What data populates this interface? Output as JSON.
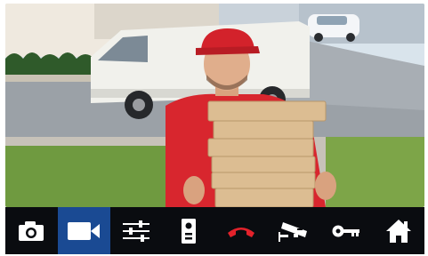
{
  "camera_feed": {
    "description": "",
    "colors": {
      "sky": "#cfe0f0",
      "road": "#8e9399",
      "grass": "#7aa64a",
      "van": "#f2f2ee",
      "shirt": "#d8262e",
      "cap": "#d3222b",
      "boxes": "#d9b98c"
    }
  },
  "toolbar": {
    "active_index": 1,
    "accent_color": "#1a4a93",
    "hangup_color": "#e3222b",
    "icon_color": "#ffffff",
    "buttons": [
      {
        "name": "snapshot",
        "icon": "camera-icon"
      },
      {
        "name": "record-video",
        "icon": "video-camera-icon"
      },
      {
        "name": "settings",
        "icon": "sliders-icon"
      },
      {
        "name": "door-panel",
        "icon": "intercom-panel-icon"
      },
      {
        "name": "hang-up",
        "icon": "phone-hangup-icon"
      },
      {
        "name": "cctv",
        "icon": "cctv-camera-icon"
      },
      {
        "name": "unlock",
        "icon": "key-icon"
      },
      {
        "name": "home",
        "icon": "home-icon"
      }
    ]
  }
}
